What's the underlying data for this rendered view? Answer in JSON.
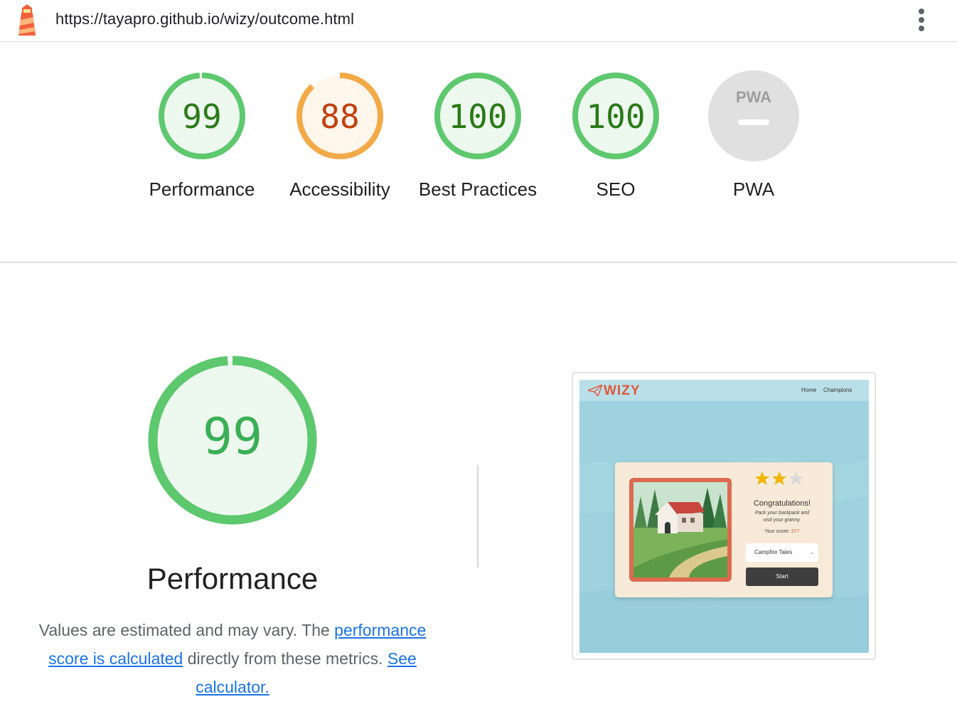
{
  "url": "https://tayapro.github.io/wizy/outcome.html",
  "colors": {
    "pass": "#0cce6b",
    "pass_ring": "#5ec86f",
    "pass_fill": "#edf8ef",
    "pass_text": "#2a7a17",
    "average_ring": "#f2aa48",
    "average_fill": "#fff6ec",
    "average_text": "#c1410f",
    "na_fill": "#e0e0e0",
    "na_text": "#9e9e9e",
    "link": "#1a73e8"
  },
  "categories": [
    {
      "id": "performance",
      "score": "99",
      "label": "Performance",
      "rating": "pass",
      "fraction": 0.99
    },
    {
      "id": "accessibility",
      "score": "88",
      "label": "Accessibility",
      "rating": "average",
      "fraction": 0.88
    },
    {
      "id": "best-practices",
      "score": "100",
      "label": "Best Practices",
      "rating": "pass",
      "fraction": 1.0
    },
    {
      "id": "seo",
      "score": "100",
      "label": "SEO",
      "rating": "pass",
      "fraction": 1.0
    },
    {
      "id": "pwa",
      "score": "PWA",
      "label": "PWA",
      "rating": "na",
      "fraction": 0
    }
  ],
  "performance": {
    "score": "99",
    "fraction": 0.99,
    "title": "Performance",
    "desc_prefix": "Values are estimated and may vary. The ",
    "link1": "performance score is calculated",
    "desc_middle": " directly from these metrics. ",
    "link2": "See calculator."
  },
  "screenshot": {
    "logo": "WIZY",
    "nav": [
      "Home",
      "Champions"
    ],
    "stars_filled": 2,
    "stars_total": 3,
    "congrats": "Congratulations!",
    "message_line1": "Pack your backpack and",
    "message_line2": "visit your granny.",
    "score_label": "Your score: ",
    "score_value": "377",
    "select_value": "Campfire Tales",
    "start_label": "Start"
  }
}
